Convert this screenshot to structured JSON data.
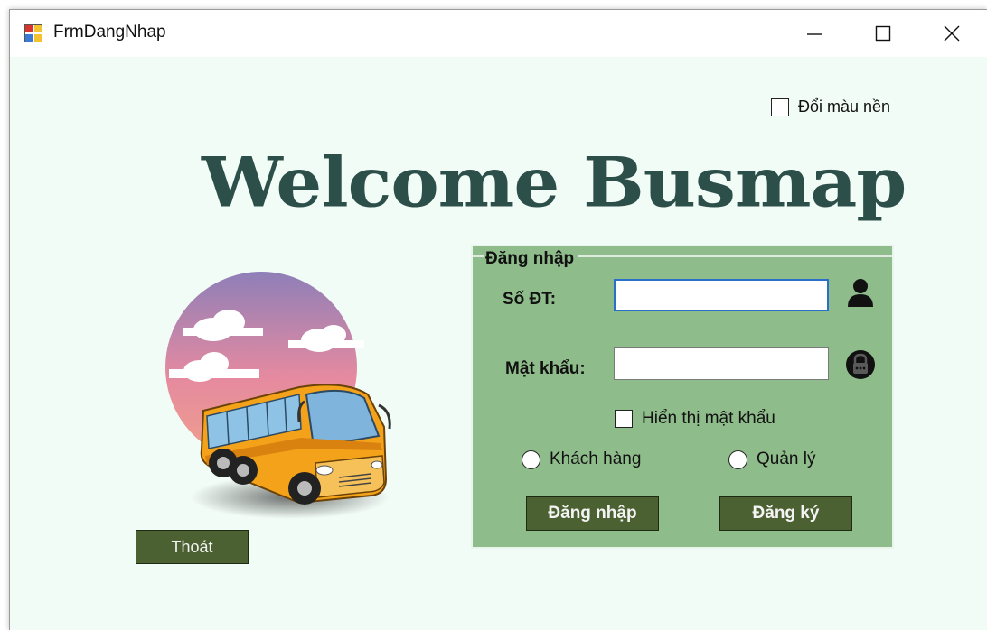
{
  "window": {
    "title": "FrmDangNhap",
    "controls": {
      "minimize": "minimize-icon",
      "maximize": "maximize-icon",
      "close": "close-icon"
    }
  },
  "background_toggle": {
    "label": "Đổi màu nền",
    "checked": false
  },
  "welcome_text": "Welcome Busmap",
  "login": {
    "legend": "Đăng nhập",
    "phone_label": "Số ĐT:",
    "phone_value": "",
    "phone_icon": "user-icon",
    "password_label": "Mật khẩu:",
    "password_value": "",
    "password_icon": "lock-icon",
    "show_password_label": "Hiển thị mật khẩu",
    "show_password_checked": false,
    "role_customer_label": "Khách hàng",
    "role_admin_label": "Quản lý",
    "login_button": "Đăng nhập",
    "register_button": "Đăng ký"
  },
  "exit_button": "Thoát",
  "colors": {
    "background": "#f2fcf7",
    "title_text": "#2d4f4a",
    "panel": "#8fbc8b",
    "button": "#4b6131"
  }
}
